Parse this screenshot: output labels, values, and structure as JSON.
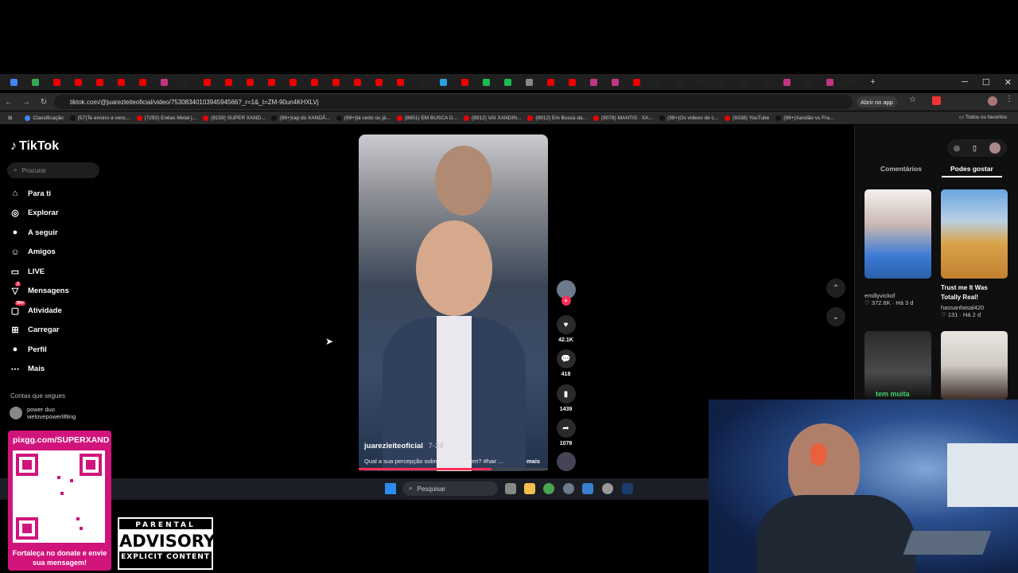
{
  "browser": {
    "tab_count": 40,
    "url": "tiktok.com/@juarezleiteoficial/video/7530834010394594566?_r=1&_t=ZM-90un4KHXLVj",
    "open_in_app": "Abrir no app",
    "bookmarks": [
      {
        "label": "Classificação",
        "color": "#4285f4"
      },
      {
        "label": "(57)Te ensino a venc...",
        "color": "#111"
      },
      {
        "label": "(7292) Enéas Metal |...",
        "color": "#e00"
      },
      {
        "label": "(8159) SUPER XAND...",
        "color": "#e00"
      },
      {
        "label": "(99+)rap do XANDÃ...",
        "color": "#111"
      },
      {
        "label": "(99+)tá cedo ou já...",
        "color": "#111"
      },
      {
        "label": "(8851) EM BUSCA D...",
        "color": "#e00"
      },
      {
        "label": "(8912) VAI XANDIN...",
        "color": "#e00"
      },
      {
        "label": "(8912) Em Busca da...",
        "color": "#e00"
      },
      {
        "label": "(9078) MANTIS · XA...",
        "color": "#e00"
      },
      {
        "label": "(99+)Os vídeos de c...",
        "color": "#111"
      },
      {
        "label": "(9338) YouTube",
        "color": "#e00"
      },
      {
        "label": "(99+)Xandão vs Fra...",
        "color": "#111"
      }
    ],
    "all_favorites": "Todos os favoritos"
  },
  "tiktok": {
    "logo": "TikTok",
    "search_placeholder": "Procurar",
    "nav": [
      {
        "label": "Para ti",
        "icon": "home-icon"
      },
      {
        "label": "Explorar",
        "icon": "compass-icon"
      },
      {
        "label": "A seguir",
        "icon": "following-icon"
      },
      {
        "label": "Amigos",
        "icon": "friends-icon"
      },
      {
        "label": "LIVE",
        "icon": "live-icon"
      },
      {
        "label": "Mensagens",
        "icon": "messages-icon",
        "badge": "2"
      },
      {
        "label": "Atividade",
        "icon": "activity-icon",
        "badge": "99+"
      },
      {
        "label": "Carregar",
        "icon": "upload-icon"
      },
      {
        "label": "Perfil",
        "icon": "profile-icon"
      },
      {
        "label": "Mais",
        "icon": "more-icon"
      }
    ],
    "following_title": "Contas que segues",
    "following": [
      {
        "name": "power duo",
        "handle": "welovepowerlifting"
      }
    ],
    "video": {
      "author": "juarezleiteoficial",
      "date": "7-24",
      "caption": "Qual a sua percepção sobre a sua imagem? #hair ...",
      "more": "mais",
      "progress": 0.7,
      "likes": "42.1K",
      "comments": "418",
      "saves": "1439",
      "shares": "1078"
    },
    "right_panel": {
      "tab_comments": "Comentários",
      "tab_likes": "Podes gostar",
      "suggestions": [
        {
          "title": "",
          "author": "emillyvickof",
          "likes": "372.6K",
          "age": "Há 3 d"
        },
        {
          "title": "Trust me It Was Totally Real!",
          "author": "hassanfaisal420",
          "likes": "131",
          "age": "Há 2 d"
        },
        {
          "title": "",
          "author": "",
          "likes": "",
          "age": "",
          "overlay": "tem muita"
        },
        {
          "title": "",
          "author": "",
          "likes": "",
          "age": ""
        }
      ]
    }
  },
  "taskbar": {
    "search_placeholder": "Pesquisar"
  },
  "overlay": {
    "donate_url": "pixgg.com/SUPERXAND",
    "donate_msg": "Fortaleça no donate e envie sua mensagem!",
    "advisory_top": "PARENTAL",
    "advisory_mid": "ADVISORY",
    "advisory_bottom": "EXPLICIT CONTENT"
  }
}
